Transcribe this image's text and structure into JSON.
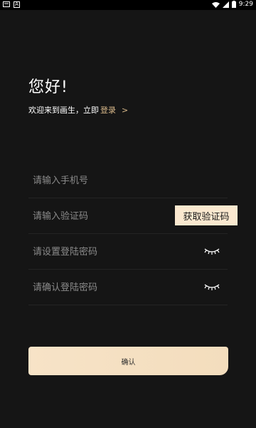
{
  "status_bar": {
    "time": "9:29",
    "left_icons": [
      "notification-icon",
      "app-a-icon"
    ],
    "right_icons": [
      "wifi-icon",
      "signal-icon",
      "battery-icon"
    ],
    "app_badge": "A"
  },
  "header": {
    "greeting": "您好!",
    "welcome_text": "欢迎来到画生，立即",
    "login_link": "登录",
    "login_arrow": ">"
  },
  "form": {
    "phone_placeholder": "请输入手机号",
    "code_placeholder": "请输入验证码",
    "get_code_label": "获取验证码",
    "password_placeholder": "请设置登陆密码",
    "confirm_password_placeholder": "请确认登陆密码",
    "confirm_label": "确认"
  },
  "colors": {
    "background": "#151515",
    "accent_gold": "#d9b98a",
    "button_fill": "#f7e3c7"
  }
}
